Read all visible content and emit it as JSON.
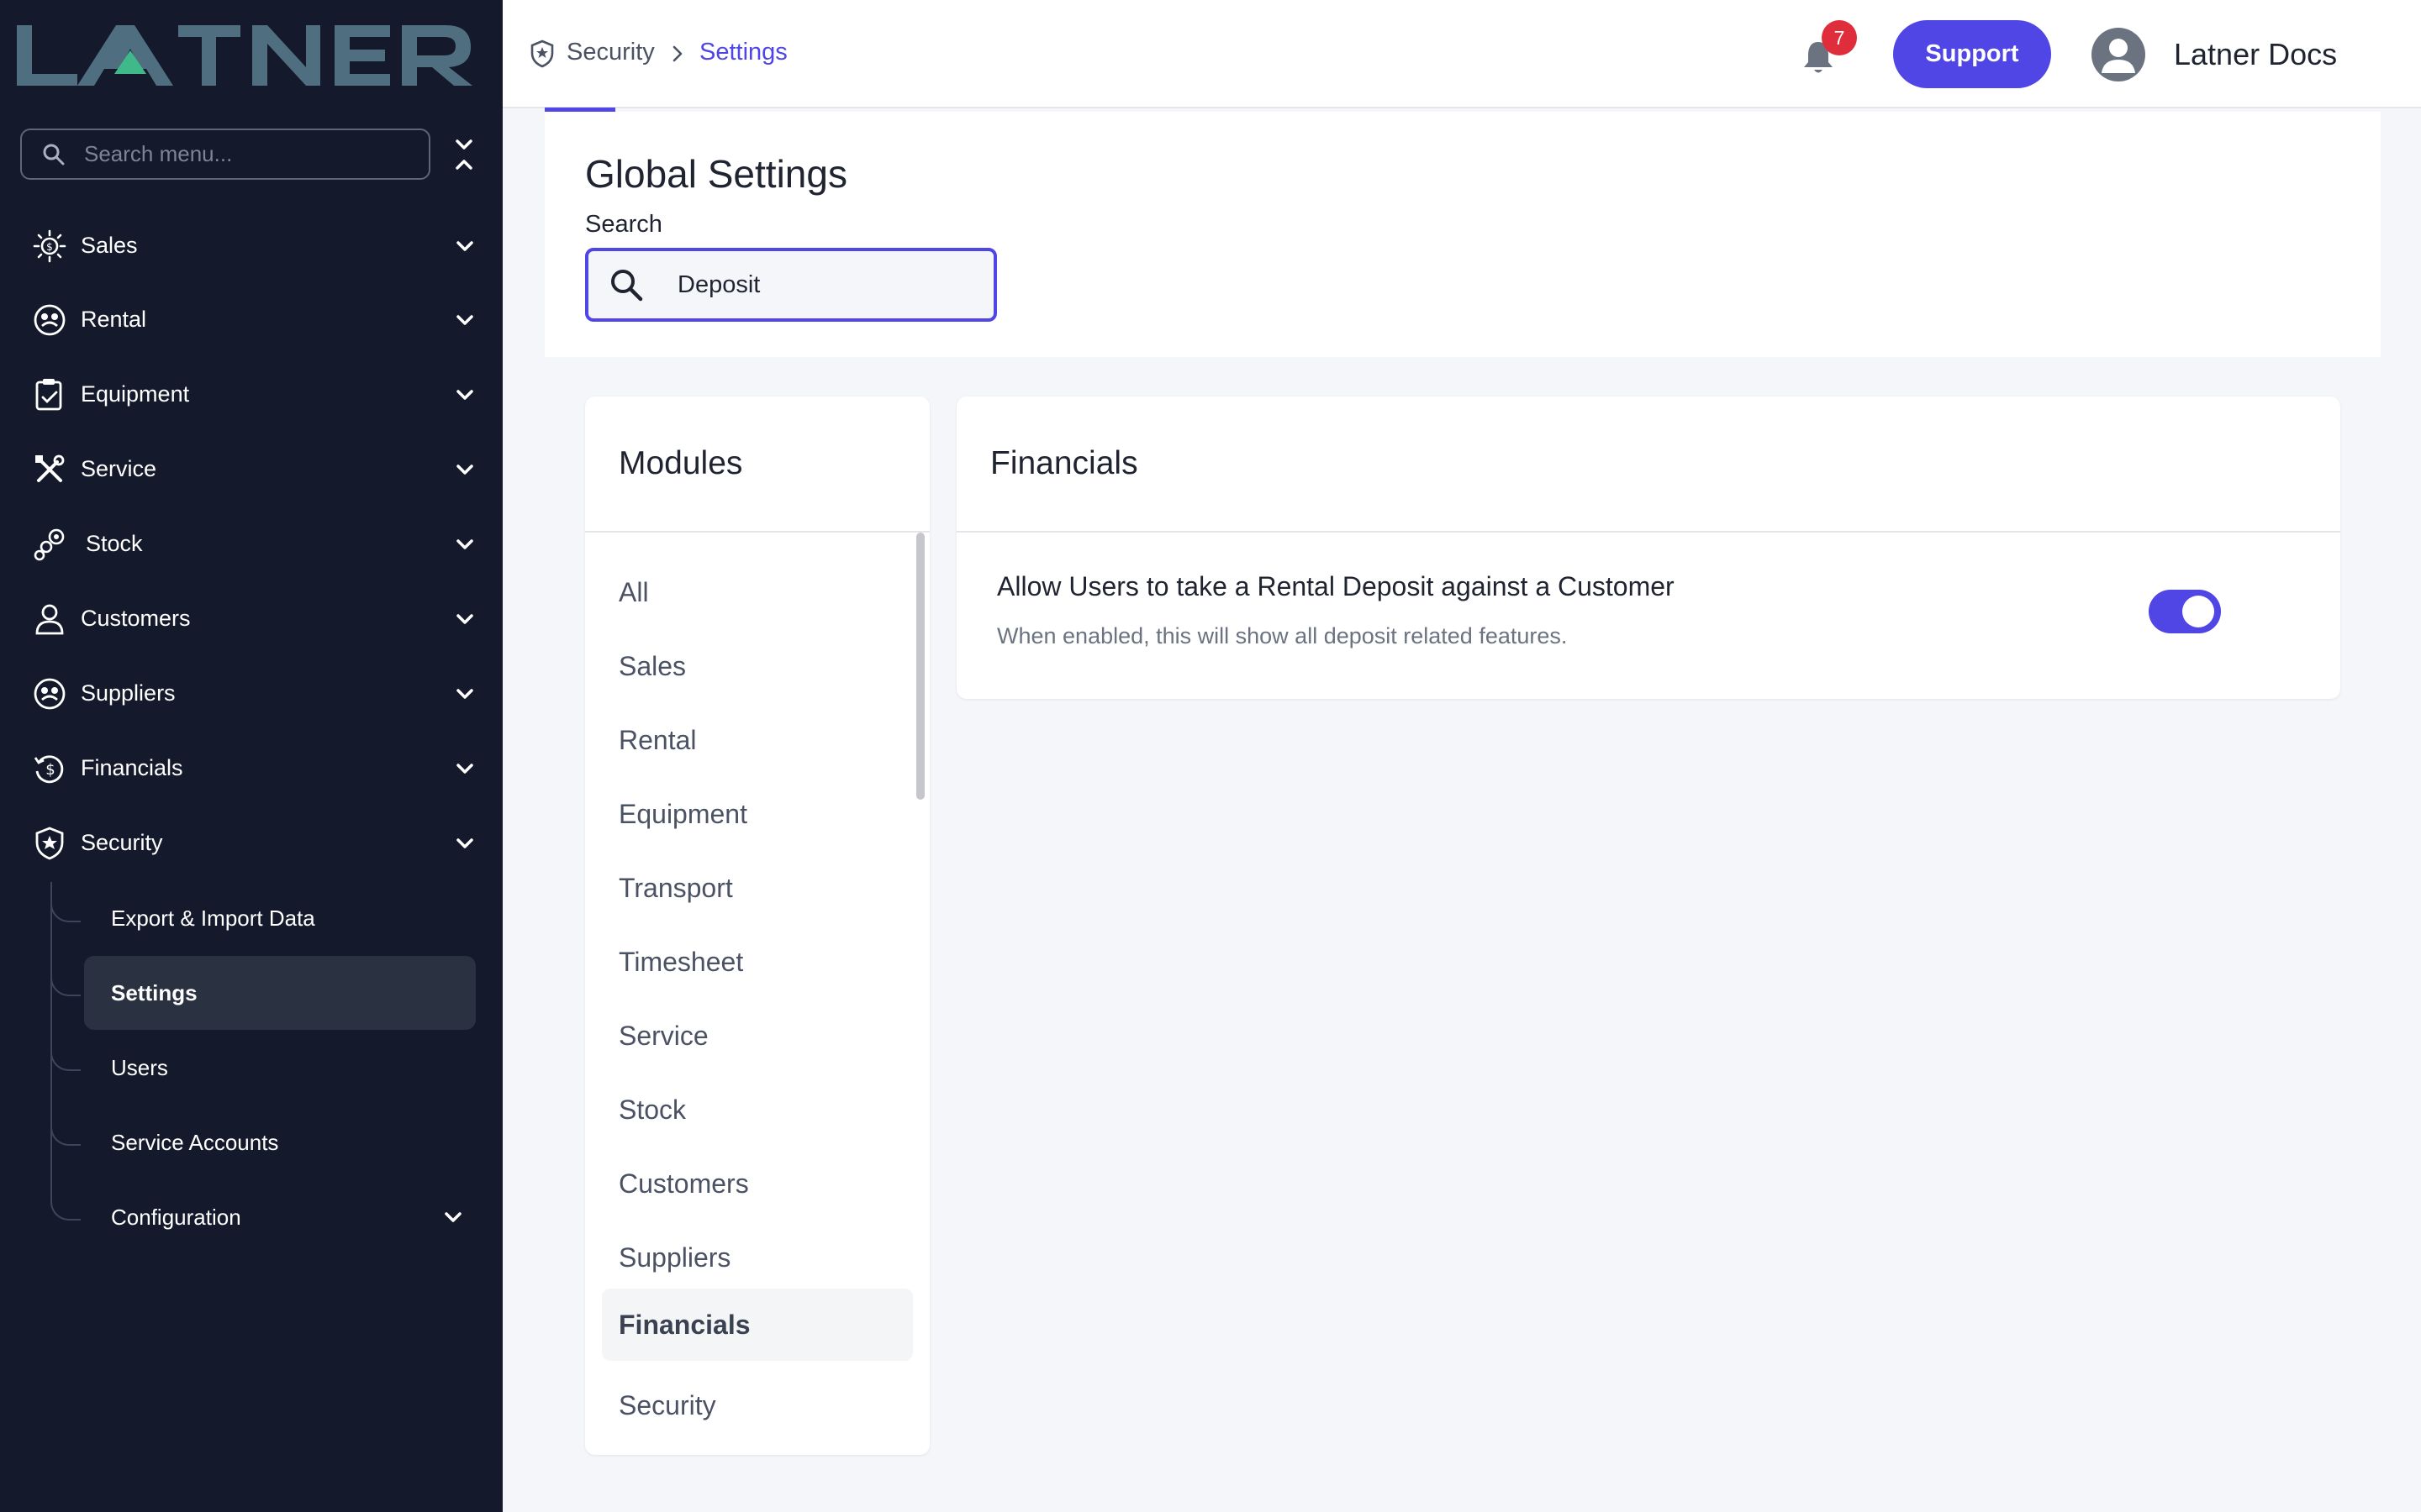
{
  "brand": {
    "logo_text": "LATNER",
    "logo_color": "#4f6f80",
    "logo_accent": "#3fb98a"
  },
  "colors": {
    "accent": "#4f46e5",
    "sidebar_bg": "#141a2b",
    "badge": "#e02d3c"
  },
  "sidebar": {
    "search_placeholder": "Search menu...",
    "items": [
      {
        "label": "Sales",
        "icon": "sales-icon"
      },
      {
        "label": "Rental",
        "icon": "rental-icon"
      },
      {
        "label": "Equipment",
        "icon": "equipment-icon"
      },
      {
        "label": "Service",
        "icon": "service-icon"
      },
      {
        "label": "Stock",
        "icon": "stock-icon"
      },
      {
        "label": "Customers",
        "icon": "customers-icon"
      },
      {
        "label": "Suppliers",
        "icon": "suppliers-icon"
      },
      {
        "label": "Financials",
        "icon": "financials-icon"
      },
      {
        "label": "Security",
        "icon": "security-icon"
      }
    ],
    "security_children": [
      {
        "label": "Export & Import Data"
      },
      {
        "label": "Settings",
        "active": true
      },
      {
        "label": "Users"
      },
      {
        "label": "Service Accounts"
      },
      {
        "label": "Configuration",
        "expandable": true
      }
    ]
  },
  "header": {
    "breadcrumb": [
      "Security",
      "Settings"
    ],
    "notification_count": "7",
    "support_label": "Support",
    "user_name": "Latner Docs"
  },
  "main": {
    "title": "Global Settings",
    "search_label": "Search",
    "search_value": "Deposit",
    "modules": {
      "title": "Modules",
      "items": [
        "All",
        "Sales",
        "Rental",
        "Equipment",
        "Transport",
        "Timesheet",
        "Service",
        "Stock",
        "Customers",
        "Suppliers",
        "Financials",
        "Security"
      ],
      "active": "Financials"
    },
    "section": {
      "title": "Financials",
      "settings": [
        {
          "title": "Allow Users to take a Rental Deposit against a Customer",
          "description": "When enabled, this will show all deposit related features.",
          "enabled": true
        }
      ]
    }
  }
}
